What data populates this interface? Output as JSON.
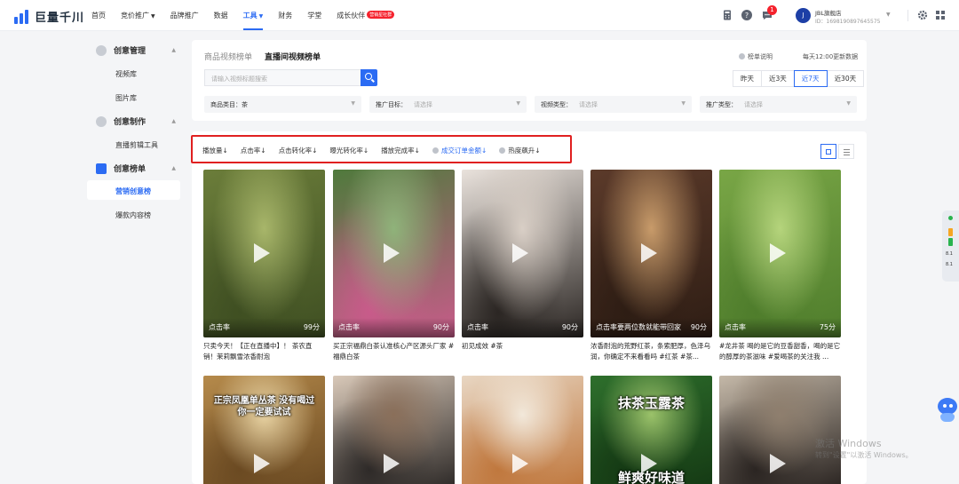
{
  "brand": {
    "name": "巨量千川"
  },
  "topnav": {
    "items": [
      {
        "label": "首页"
      },
      {
        "label": "竞价推广",
        "dropdown": true
      },
      {
        "label": "品牌推广"
      },
      {
        "label": "数据"
      },
      {
        "label": "工具",
        "dropdown": true,
        "active": true
      },
      {
        "label": "财务"
      },
      {
        "label": "学堂"
      },
      {
        "label": "成长伙伴",
        "badge": "营销星社群"
      }
    ],
    "notification_count": "1",
    "account": {
      "avatar_letter": "J",
      "name": "JBL旗舰店",
      "id": "ID：1698190897645575"
    }
  },
  "sidebar": {
    "groups": [
      {
        "label": "创意管理",
        "items": [
          "视频库",
          "图片库"
        ]
      },
      {
        "label": "创意制作",
        "items": [
          "直播剪辑工具"
        ]
      },
      {
        "label": "创意榜单",
        "items": [
          "营销创意榜",
          "爆款内容榜"
        ]
      }
    ],
    "active_item": "营销创意榜"
  },
  "filters": {
    "tabs": [
      "商品视频榜单",
      "直播间视频榜单"
    ],
    "active_tab": "直播间视频榜单",
    "search": {
      "placeholder": "请输入视频标题搜索"
    },
    "rule_link": "榜单说明",
    "update_note": "每天12:00更新数据",
    "date_buttons": [
      "昨天",
      "近3天",
      "近7天",
      "近30天"
    ],
    "active_date": "近7天",
    "selects": [
      {
        "label": "商品类目：",
        "value": "茶"
      },
      {
        "label": "推广目标：",
        "placeholder": "请选择"
      },
      {
        "label": "视频类型：",
        "placeholder": "请选择"
      },
      {
        "label": "推广类型：",
        "placeholder": "请选择"
      }
    ]
  },
  "sort_bar": {
    "items": [
      {
        "label": "播放量↓"
      },
      {
        "label": "点击率↓"
      },
      {
        "label": "点击转化率↓"
      },
      {
        "label": "曝光转化率↓"
      },
      {
        "label": "播放完成率↓"
      },
      {
        "label": "成交订单金额↓",
        "help": true,
        "active": true
      },
      {
        "label": "热度飙升↓",
        "help": true
      }
    ]
  },
  "videos": [
    {
      "metric": "点击率",
      "score": "99分",
      "title": "只卖今天！【正在直播中】！ 茶农直销！茉莉飘雪浓香耐泡",
      "palette": [
        "#6b7d3a",
        "#a8b66a",
        "#3f4f22"
      ]
    },
    {
      "metric": "点击率",
      "score": "90分",
      "title": "买正宗福鼎白茶认准核心产区源头厂家 #福鼎白茶",
      "palette": [
        "#4f7a3c",
        "#8fb37a",
        "#c85b8a"
      ]
    },
    {
      "metric": "点击率",
      "score": "90分",
      "title": "初见成效 #茶",
      "palette": [
        "#e9e2dc",
        "#d9cfc6",
        "#2b2623"
      ]
    },
    {
      "metric": "点击率",
      "score": "90分",
      "overlay": "要两位数就能带回家",
      "title": "浓香耐泡的荒野红茶，条索肥厚，色泽乌润，你确定不来看看吗 #红茶 #茶...",
      "palette": [
        "#5b3a2a",
        "#c89b6a",
        "#2e1d14"
      ]
    },
    {
      "metric": "点击率",
      "score": "75分",
      "title": "#龙井茶 喝的是它的豆香甜香，喝的是它的醇厚的茶滋味 #爱喝茶的关注我 ...",
      "palette": [
        "#79a646",
        "#b5d47c",
        "#4f7d2c"
      ]
    },
    {
      "overlay_top": "正宗凤凰单丛茶 没有喝过你一定要试试",
      "palette": [
        "#b58a4b",
        "#e8d3a3",
        "#6b4a22"
      ]
    },
    {
      "palette": [
        "#d8c8b8",
        "#8a6f5a",
        "#2e2a28"
      ]
    },
    {
      "palette": [
        "#e8d6c2",
        "#f2e8da",
        "#c0783e"
      ]
    },
    {
      "overlay_top": "抹茶玉露茶",
      "overlay_bottom": "鲜爽好味道",
      "palette": [
        "#2e6f2c",
        "#9bc26a",
        "#153a14"
      ]
    },
    {
      "palette": [
        "#c4b8a8",
        "#8f7f6e",
        "#2b2522"
      ]
    }
  ],
  "right_panel": {
    "values": [
      "8.1",
      "8.1"
    ]
  },
  "watermark": {
    "line1": "激活 Windows",
    "line2": "转到\"设置\"以激活 Windows。"
  }
}
